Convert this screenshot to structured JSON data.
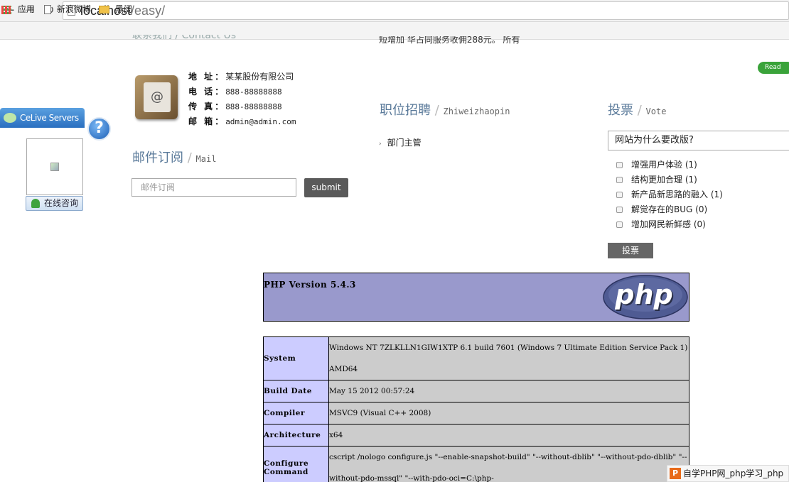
{
  "browser": {
    "url_host": "localhost",
    "url_path": "/easy/",
    "bookmarks": [
      "应用",
      "新浪微博",
      "黑阔"
    ]
  },
  "top_cutoff": {
    "left": "联系我们 / Contact Us",
    "middle": "短增加  华占同服务收佣288元。  所有"
  },
  "read_more": "Read More",
  "contact": {
    "address_label": "地  址：",
    "address": "某某股份有限公司",
    "phone_label": "电  话：",
    "phone": "888-88888888",
    "fax_label": "传  真：",
    "fax": "888-88888888",
    "email_label": "邮  箱：",
    "email": "admin@admin.com"
  },
  "mail": {
    "title": "邮件订阅",
    "subtitle": "Mail",
    "placeholder": "邮件订阅",
    "submit": "submit"
  },
  "jobs": {
    "title": "职位招聘",
    "subtitle": "Zhiweizhaopin",
    "items": [
      "部门主管"
    ]
  },
  "vote": {
    "title": "投票",
    "subtitle": "Vote",
    "question": "网站为什么要改版?",
    "options": [
      {
        "label": "增强用户体验",
        "count": "(1)"
      },
      {
        "label": "结构更加合理",
        "count": "(1)"
      },
      {
        "label": "新产品新思路的融入",
        "count": "(1)"
      },
      {
        "label": "解觉存在的BUG",
        "count": "(0)"
      },
      {
        "label": "增加网民新鲜感",
        "count": "(0)"
      }
    ],
    "button": "投票"
  },
  "celive": {
    "title": "CeLive Servers",
    "consult": "在线咨询"
  },
  "phpinfo": {
    "version": "PHP Version 5.4.3",
    "logo": "php",
    "rows": [
      {
        "key": "System",
        "value": "Windows NT 7ZLKLLN1GIW1XTP 6.1 build 7601 (Windows 7 Ultimate Edition Service Pack 1) AMD64"
      },
      {
        "key": "Build Date",
        "value": "May 15 2012 00:57:24"
      },
      {
        "key": "Compiler",
        "value": "MSVC9 (Visual C++ 2008)"
      },
      {
        "key": "Architecture",
        "value": "x64"
      },
      {
        "key": "Configure Command",
        "value": "cscript /nologo configure.js \"--enable-snapshot-build\" \"--without-dblib\" \"--without-pdo-dblib\" \"--without-pdo-mssql\" \"--with-pdo-oci=C:\\php-"
      }
    ]
  },
  "watermark": "自学PHP网_php学习_php教"
}
